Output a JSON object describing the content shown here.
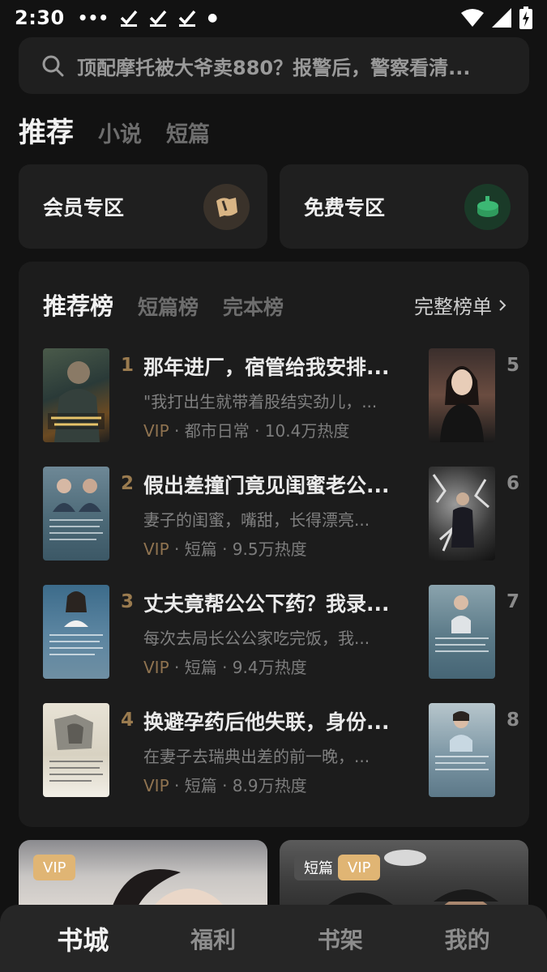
{
  "status_bar": {
    "time": "2:30",
    "icons": [
      "more-icon",
      "check-icon",
      "check-icon",
      "check-icon",
      "dot-icon",
      "wifi-icon",
      "signal-icon",
      "battery-charging-icon"
    ]
  },
  "search": {
    "placeholder": "顶配摩托被大爷卖880？报警后，警察看清..."
  },
  "top_tabs": [
    {
      "label": "推荐",
      "active": true
    },
    {
      "label": "小说",
      "active": false
    },
    {
      "label": "短篇",
      "active": false
    }
  ],
  "zones": [
    {
      "label": "会员专区",
      "icon": "vip-zone-icon",
      "color": "#c8a67a"
    },
    {
      "label": "免费专区",
      "icon": "free-zone-icon",
      "color": "#2f9b5d"
    }
  ],
  "ranking": {
    "tabs": [
      {
        "label": "推荐榜",
        "active": true
      },
      {
        "label": "短篇榜",
        "active": false
      },
      {
        "label": "完本榜",
        "active": false
      }
    ],
    "full_list": "完整榜单",
    "items": [
      {
        "rank": "1",
        "title": "那年进厂，宿管给我安排...",
        "desc": "\"我打出生就带着股结实劲儿，...",
        "vip": "VIP",
        "genre": "都市日常",
        "heat": "10.4万热度"
      },
      {
        "rank": "2",
        "title": "假出差撞门竟见闺蜜老公...",
        "desc": "妻子的闺蜜，嘴甜，长得漂亮...",
        "vip": "VIP",
        "genre": "短篇",
        "heat": "9.5万热度"
      },
      {
        "rank": "3",
        "title": "丈夫竟帮公公下药？我录...",
        "desc": "每次去局长公公家吃完饭，我...",
        "vip": "VIP",
        "genre": "短篇",
        "heat": "9.4万热度"
      },
      {
        "rank": "4",
        "title": "换避孕药后他失联，身份...",
        "desc": "在妻子去瑞典出差的前一晚，...",
        "vip": "VIP",
        "genre": "短篇",
        "heat": "8.9万热度"
      }
    ],
    "second_column_ranks": [
      "5",
      "6",
      "7",
      "8"
    ]
  },
  "bottom_cards": [
    {
      "tags": [
        "VIP"
      ]
    },
    {
      "tags": [
        "短篇",
        "VIP"
      ]
    }
  ],
  "bottom_nav": [
    {
      "label": "书城",
      "active": true
    },
    {
      "label": "福利",
      "active": false
    },
    {
      "label": "书架",
      "active": false
    },
    {
      "label": "我的",
      "active": false
    }
  ]
}
